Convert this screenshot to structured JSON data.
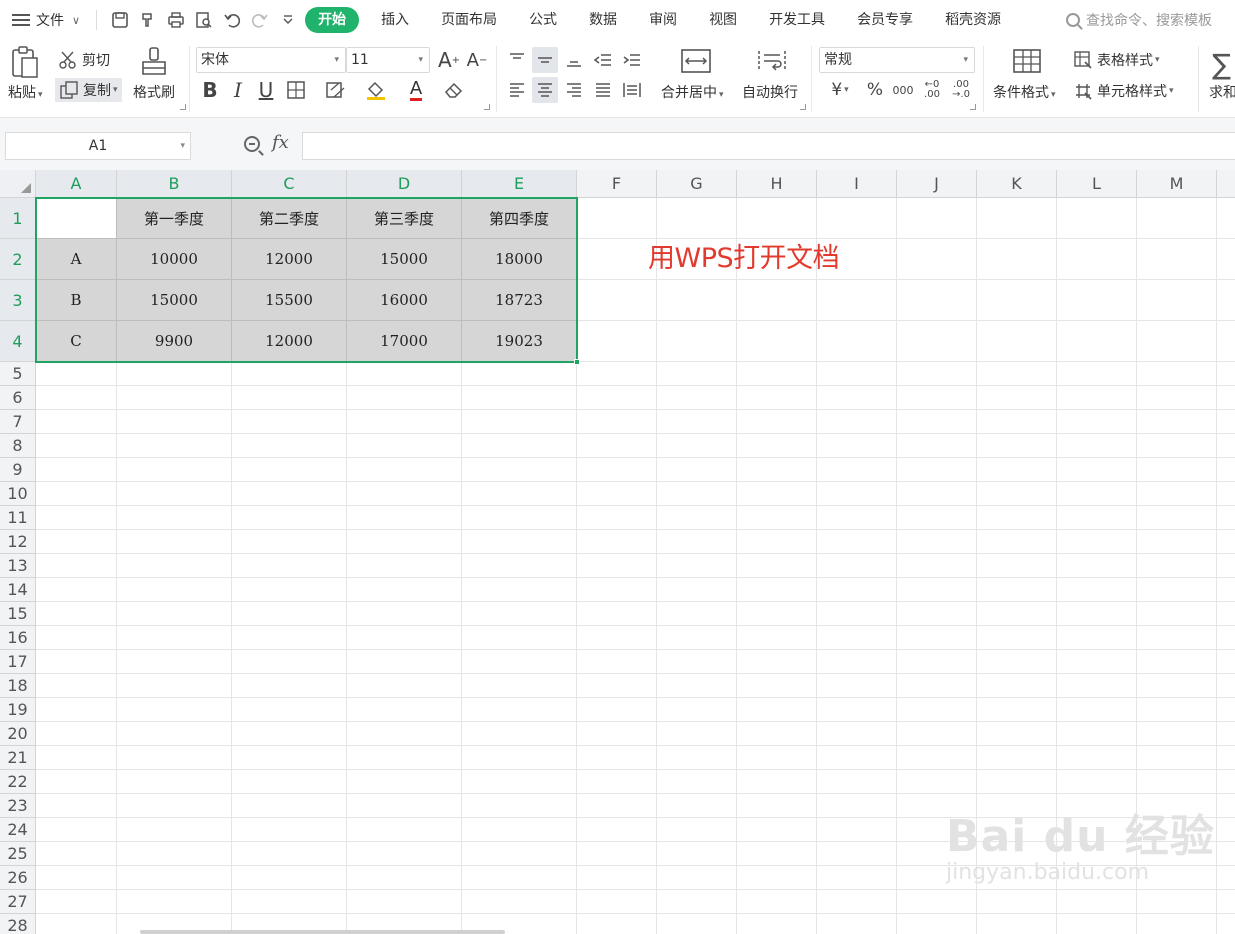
{
  "menubar": {
    "file_label": "文件",
    "tabs": [
      "开始",
      "插入",
      "页面布局",
      "公式",
      "数据",
      "审阅",
      "视图",
      "开发工具",
      "会员专享",
      "稻壳资源"
    ],
    "search_placeholder": "查找命令、搜索模板"
  },
  "ribbon": {
    "paste": "粘贴",
    "cut": "剪切",
    "copy": "复制",
    "format_painter": "格式刷",
    "font_name": "宋体",
    "font_size": "11",
    "merge_center": "合并居中",
    "wrap_text": "自动换行",
    "number_format": "常规",
    "conditional_format": "条件格式",
    "table_style": "表格样式",
    "cell_style": "单元格样式",
    "sum": "求和",
    "bold": "B",
    "italic": "I",
    "underline": "U",
    "currency": "¥",
    "percent": "%",
    "thousands": "000",
    "dec_increase": "←0 .00",
    "dec_decrease": ".00 →.0",
    "font_grow": "A",
    "font_shrink": "A",
    "font_color": "A"
  },
  "formula_bar": {
    "name_box": "A1",
    "fx_label": "fx",
    "formula": ""
  },
  "sheet": {
    "columns": [
      "A",
      "B",
      "C",
      "D",
      "E",
      "F",
      "G",
      "H",
      "I",
      "J",
      "K",
      "L",
      "M"
    ],
    "rows": [
      "1",
      "2",
      "3",
      "4",
      "5",
      "6",
      "7",
      "8",
      "9",
      "10",
      "11",
      "12",
      "13",
      "14",
      "15",
      "16",
      "17",
      "18",
      "19",
      "20",
      "21",
      "22",
      "23",
      "24",
      "25",
      "26",
      "27",
      "28"
    ],
    "table": [
      [
        "",
        "第一季度",
        "第二季度",
        "第三季度",
        "第四季度"
      ],
      [
        "A",
        "10000",
        "12000",
        "15000",
        "18000"
      ],
      [
        "B",
        "15000",
        "15500",
        "16000",
        "18723"
      ],
      [
        "C",
        "9900",
        "12000",
        "17000",
        "19023"
      ]
    ],
    "annotation": "用WPS打开文档"
  },
  "watermark": {
    "main": "Bai du 经验",
    "sub": "jingyan.baidu.com"
  },
  "colors": {
    "accent": "#1fb36b",
    "selection": "#1fa463",
    "annotation": "#e23b2e",
    "table_fill": "#d6d6d6"
  }
}
